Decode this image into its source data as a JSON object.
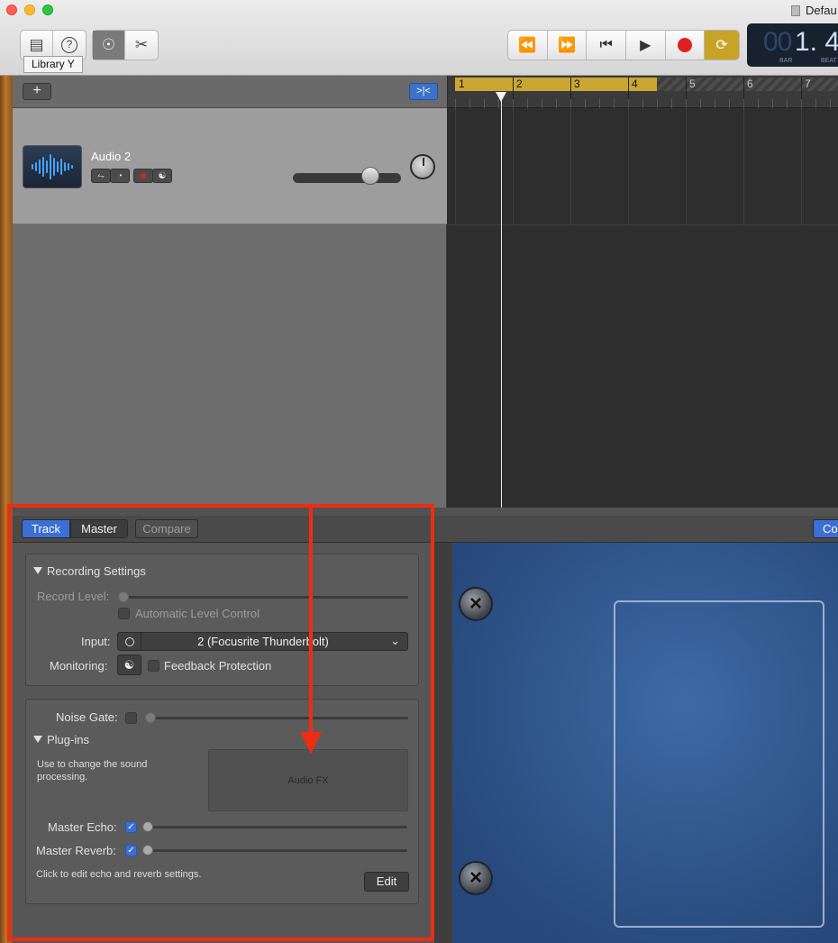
{
  "window": {
    "title": "Defau"
  },
  "toolbar": {
    "library_tooltip": "Library  Y",
    "lcd_digits": "00",
    "lcd_position": "1. 4",
    "lcd_bar_label": "BAR",
    "lcd_beat_label": "BEAT"
  },
  "track": {
    "name": "Audio 2"
  },
  "ruler": {
    "bars": [
      "1",
      "2",
      "3",
      "4",
      "5",
      "6",
      "7"
    ]
  },
  "smart_controls": {
    "tabs": {
      "track": "Track",
      "master": "Master",
      "compare": "Compare",
      "right_button": "Co"
    },
    "recording_settings": {
      "title": "Recording Settings",
      "record_level_label": "Record Level:",
      "auto_level_label": "Automatic Level Control",
      "input_label": "Input:",
      "input_value": "2  (Focusrite Thunderbolt)",
      "monitoring_label": "Monitoring:",
      "feedback_label": "Feedback Protection"
    },
    "noise_gate_label": "Noise Gate:",
    "plugins": {
      "title": "Plug-ins",
      "description": "Use to change the sound processing.",
      "audio_fx": "Audio FX"
    },
    "master_echo_label": "Master Echo:",
    "master_reverb_label": "Master Reverb:",
    "edit_hint": "Click to edit echo and reverb settings.",
    "edit_button": "Edit"
  },
  "colors": {
    "accent_blue": "#3b6fd6",
    "cycle_yellow": "#c9a632",
    "annotation_red": "#ef2b12"
  }
}
